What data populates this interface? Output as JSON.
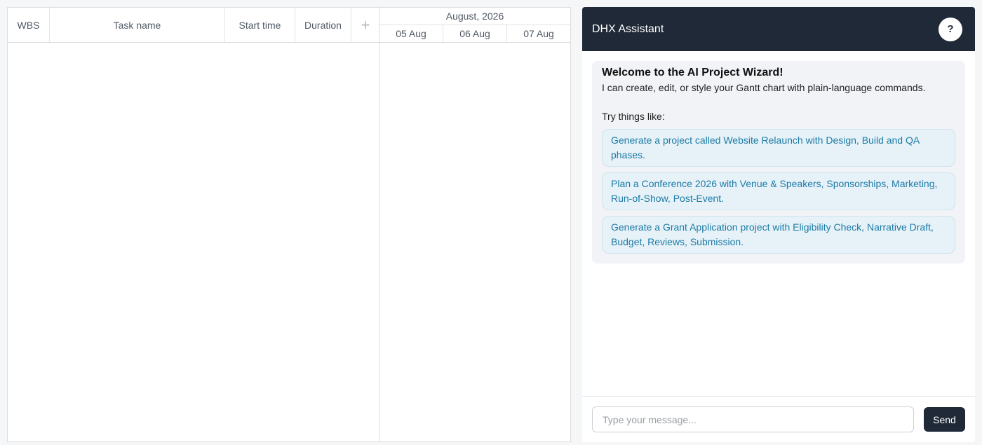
{
  "gantt": {
    "columns": {
      "wbs": "WBS",
      "task_name": "Task name",
      "start_time": "Start time",
      "duration": "Duration",
      "add": "+"
    },
    "scale": {
      "month": "August, 2026",
      "days": [
        "05 Aug",
        "06 Aug",
        "07 Aug"
      ]
    }
  },
  "assistant": {
    "title": "DHX Assistant",
    "help": "?",
    "welcome": {
      "title": "Welcome to the AI Project Wizard!",
      "description": "I can create, edit, or style your Gantt chart with plain-language commands.",
      "try_label": "Try things like:",
      "suggestions": [
        "Generate a project called Website Relaunch with Design, Build and QA phases.",
        "Plan a Conference 2026 with Venue & Speakers, Sponsorships, Marketing, Run-of-Show, Post-Event.",
        "Generate a Grant Application project with Eligibility Check, Narrative Draft, Budget, Reviews, Submission."
      ]
    },
    "input": {
      "placeholder": "Type your message...",
      "value": ""
    },
    "send_label": "Send"
  }
}
